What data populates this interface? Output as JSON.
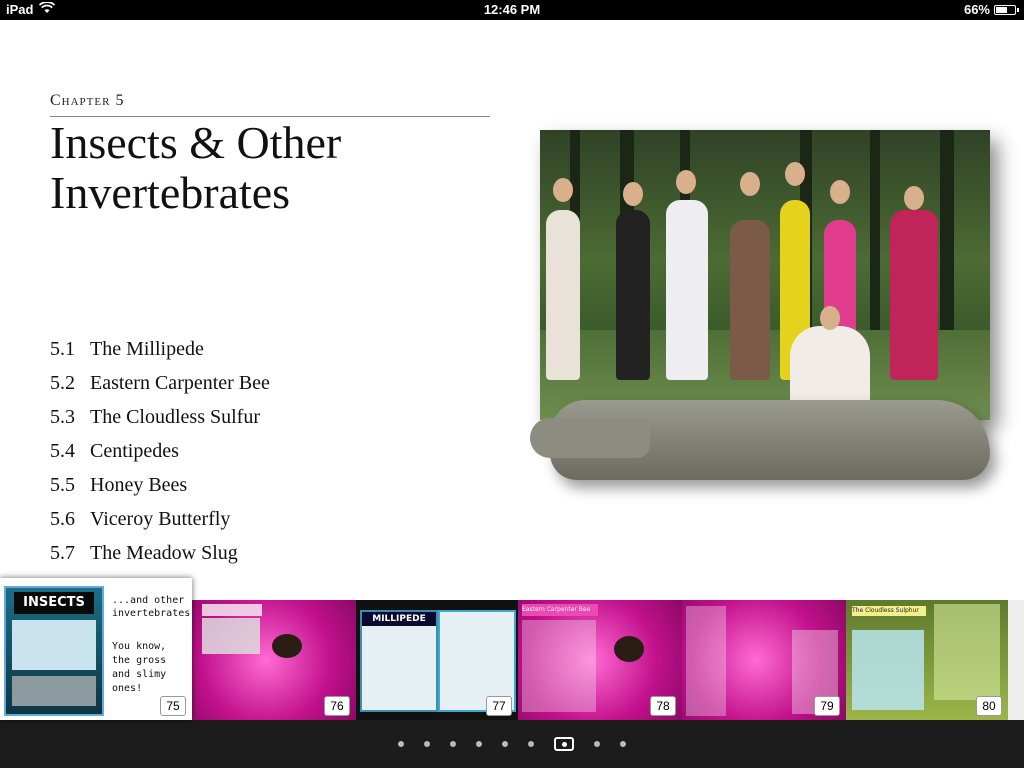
{
  "status_bar": {
    "device": "iPad",
    "time": "12:46 PM",
    "battery": "66%",
    "battery_level": 0.66
  },
  "chapter": {
    "label": "Chapter 5",
    "title": "Insects & Other Invertebrates"
  },
  "toc": [
    {
      "num": "5.1",
      "title": "The Millipede"
    },
    {
      "num": "5.2",
      "title": "Eastern Carpenter Bee"
    },
    {
      "num": "5.3",
      "title": "The Cloudless Sulfur"
    },
    {
      "num": "5.4",
      "title": "Centipedes"
    },
    {
      "num": "5.5",
      "title": "Honey Bees"
    },
    {
      "num": "5.6",
      "title": "Viceroy Butterfly"
    },
    {
      "num": "5.7",
      "title": "The Meadow Slug"
    }
  ],
  "thumbnails": {
    "p75": {
      "page": "75",
      "poster_title": "INSECTS",
      "note1": "...and other invertebrates.",
      "note2": "You know, the gross and slimy ones!"
    },
    "p76": {
      "page": "76"
    },
    "p77": {
      "page": "77",
      "poster_title": "MILLIPEDE"
    },
    "p78": {
      "page": "78",
      "heading": "Eastern Carpenter Bee"
    },
    "p79": {
      "page": "79"
    },
    "p80": {
      "page": "80",
      "heading": "The Cloudless Sulphur"
    }
  },
  "page_dots": {
    "count": 9,
    "active_index": 6
  },
  "colors": {
    "status_bar": "#000000",
    "strip": "#222222",
    "bottom_bar": "#1c1c1c",
    "accent_pink": "#ff3ec1"
  }
}
